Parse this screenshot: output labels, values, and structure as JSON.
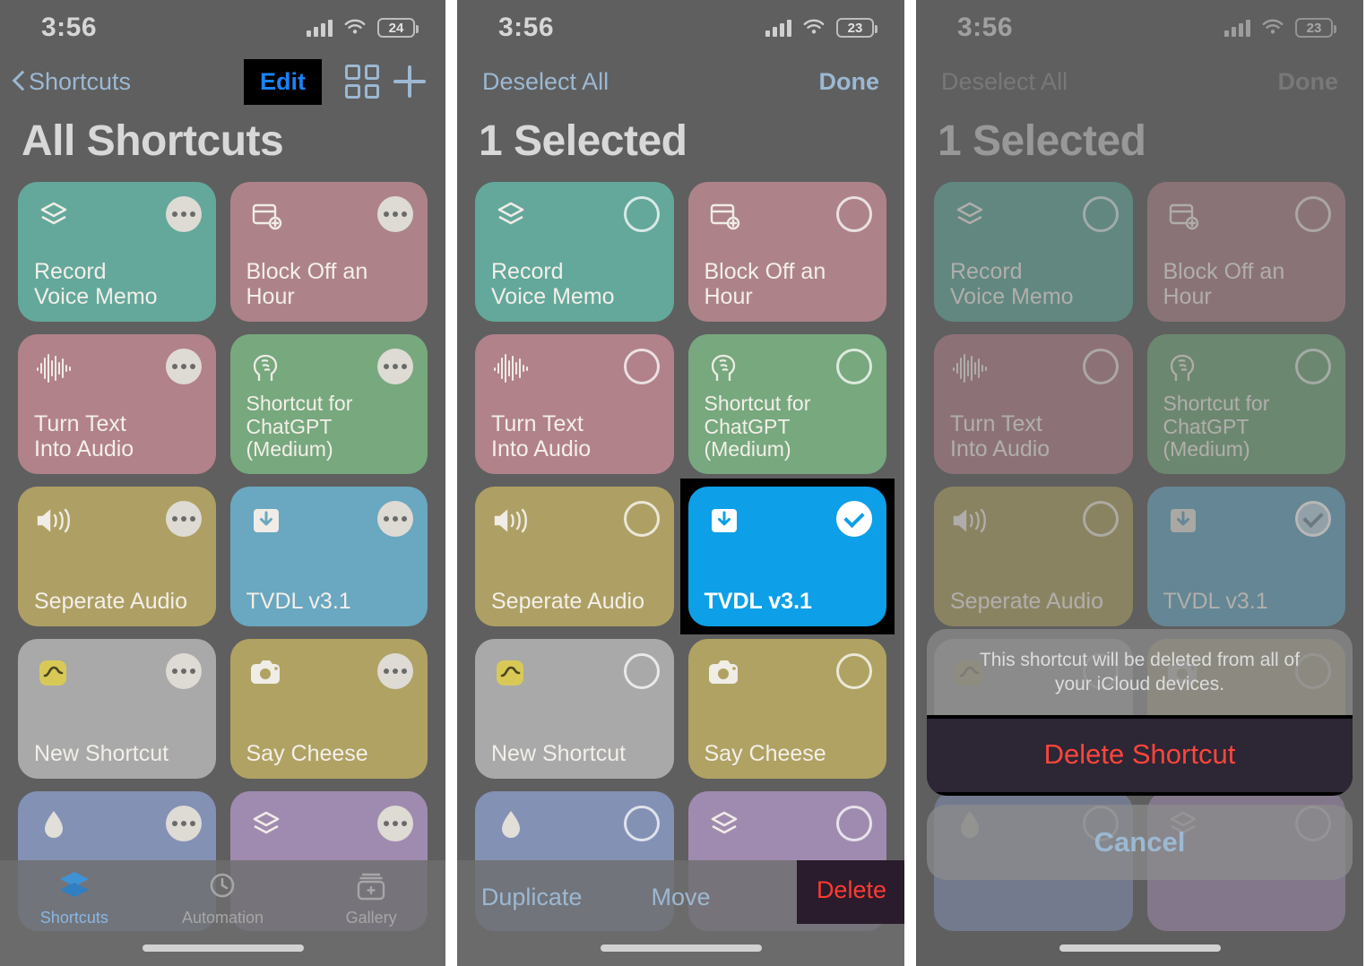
{
  "panels": [
    {
      "id": "all-shortcuts",
      "statusbar": {
        "time": "3:56",
        "battery": "24",
        "signal_icon": "cellular-bars-icon",
        "wifi_icon": "wifi-icon",
        "battery_icon": "battery-icon"
      },
      "nav": {
        "back_label": "Shortcuts",
        "edit_label": "Edit",
        "grid_icon": "grid-view-icon",
        "add_icon": "plus-icon",
        "back_icon": "chevron-left-icon"
      },
      "title": "All Shortcuts",
      "cards": [
        {
          "label": "Record\nVoice Memo",
          "color": "#63a89b",
          "icon": "layers-icon"
        },
        {
          "label": "Block Off an Hour",
          "color": "#ad8389",
          "icon": "calendar-add-icon"
        },
        {
          "label": "Turn Text\nInto Audio",
          "color": "#b1828a",
          "icon": "waveform-icon"
        },
        {
          "label": "Shortcut for\nChatGPT\n(Medium)",
          "color": "#77a87e",
          "icon": "brain-head-icon"
        },
        {
          "label": "Seperate Audio",
          "color": "#aea064",
          "icon": "speaker-waves-icon"
        },
        {
          "label": "TVDL v3.1",
          "color": "#6aa7c0",
          "icon": "tray-download-icon"
        },
        {
          "label": "New Shortcut",
          "color": "#a9a9a9",
          "icon": "health-cloud-icon"
        },
        {
          "label": "Say Cheese",
          "color": "#b0a263",
          "icon": "camera-icon"
        },
        {
          "label": "",
          "color": "#8391b5",
          "icon": "droplet-icon"
        },
        {
          "label": "",
          "color": "#a08bb0",
          "icon": "layers-icon"
        }
      ],
      "tabs": [
        {
          "label": "Shortcuts",
          "icon": "shortcuts-layers-icon",
          "active": true
        },
        {
          "label": "Automation",
          "icon": "clock-automation-icon",
          "active": false
        },
        {
          "label": "Gallery",
          "icon": "gallery-cards-icon",
          "active": false
        }
      ]
    },
    {
      "id": "selection-mode",
      "statusbar": {
        "time": "3:56",
        "battery": "23",
        "signal_icon": "cellular-bars-icon",
        "wifi_icon": "wifi-icon",
        "battery_icon": "battery-icon"
      },
      "nav": {
        "deselect_label": "Deselect All",
        "done_label": "Done"
      },
      "title": "1 Selected",
      "cards": [
        {
          "label": "Record\nVoice Memo",
          "color": "#63a89b",
          "icon": "layers-icon",
          "selected": false
        },
        {
          "label": "Block Off an Hour",
          "color": "#ad8389",
          "icon": "calendar-add-icon",
          "selected": false
        },
        {
          "label": "Turn Text\nInto Audio",
          "color": "#b1828a",
          "icon": "waveform-icon",
          "selected": false
        },
        {
          "label": "Shortcut for\nChatGPT\n(Medium)",
          "color": "#77a87e",
          "icon": "brain-head-icon",
          "selected": false
        },
        {
          "label": "Seperate Audio",
          "color": "#aea064",
          "icon": "speaker-waves-icon",
          "selected": false
        },
        {
          "label": "TVDL v3.1",
          "color": "#0d9fe8",
          "icon": "tray-download-icon",
          "selected": true
        },
        {
          "label": "New Shortcut",
          "color": "#a9a9a9",
          "icon": "health-cloud-icon",
          "selected": false
        },
        {
          "label": "Say Cheese",
          "color": "#b0a263",
          "icon": "camera-icon",
          "selected": false
        },
        {
          "label": "",
          "color": "#8391b5",
          "icon": "droplet-icon",
          "selected": false
        },
        {
          "label": "",
          "color": "#a08bb0",
          "icon": "layers-icon",
          "selected": false
        }
      ],
      "toolbar": {
        "duplicate_label": "Duplicate",
        "move_label": "Move",
        "delete_label": "Delete"
      }
    },
    {
      "id": "delete-confirm",
      "statusbar": {
        "time": "3:56",
        "battery": "23",
        "signal_icon": "cellular-bars-icon",
        "wifi_icon": "wifi-icon",
        "battery_icon": "battery-icon"
      },
      "nav": {
        "deselect_label": "Deselect All",
        "done_label": "Done"
      },
      "title": "1 Selected",
      "cards": [
        {
          "label": "Record\nVoice Memo",
          "color": "#63a89b",
          "icon": "layers-icon",
          "selected": false
        },
        {
          "label": "Block Off an Hour",
          "color": "#ad8389",
          "icon": "calendar-add-icon",
          "selected": false
        },
        {
          "label": "Turn Text\nInto Audio",
          "color": "#b1828a",
          "icon": "waveform-icon",
          "selected": false
        },
        {
          "label": "Shortcut for\nChatGPT\n(Medium)",
          "color": "#77a87e",
          "icon": "brain-head-icon",
          "selected": false
        },
        {
          "label": "Seperate Audio",
          "color": "#aea064",
          "icon": "speaker-waves-icon",
          "selected": false
        },
        {
          "label": "TVDL v3.1",
          "color": "#6aa7c0",
          "icon": "tray-download-icon",
          "selected": true
        },
        {
          "label": "New Shortcut",
          "color": "#a9a9a9",
          "icon": "health-cloud-icon",
          "selected": false
        },
        {
          "label": "Say Cheese",
          "color": "#b0a263",
          "icon": "camera-icon",
          "selected": false
        },
        {
          "label": "",
          "color": "#8391b5",
          "icon": "droplet-icon",
          "selected": false
        },
        {
          "label": "",
          "color": "#a08bb0",
          "icon": "layers-icon",
          "selected": false
        }
      ],
      "sheet": {
        "message": "This shortcut will be deleted from all of your iCloud devices.",
        "destructive_label": "Delete Shortcut",
        "cancel_label": "Cancel"
      }
    }
  ],
  "colors": {
    "ios_blue": "#0d9fe8",
    "link_blue": "#9cb8d2",
    "destructive_red": "#ff453a",
    "edit_highlight_bg": "#000000",
    "delete_highlight_bg": "#2a1c2c"
  }
}
